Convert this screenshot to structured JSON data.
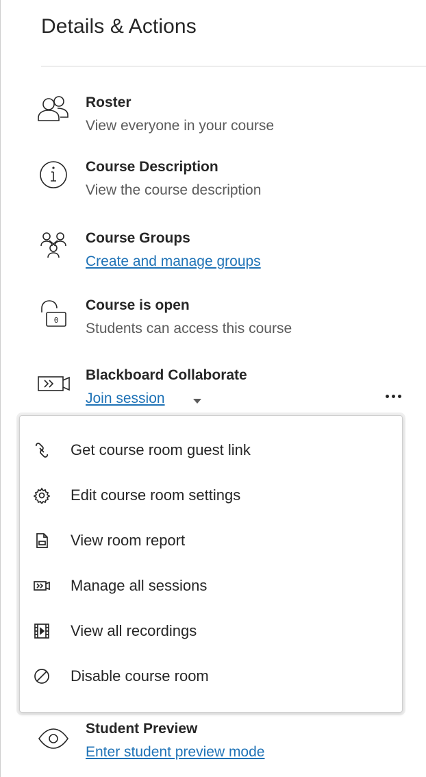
{
  "panel": {
    "title": "Details & Actions"
  },
  "items": [
    {
      "title": "Roster",
      "subtitle": "View everyone in your course"
    },
    {
      "title": "Course Description",
      "subtitle": "View the course description"
    },
    {
      "title": "Course Groups",
      "link": "Create and manage groups"
    },
    {
      "title": "Course is open",
      "subtitle": "Students can access this course"
    },
    {
      "title": "Blackboard Collaborate",
      "link": "Join session"
    }
  ],
  "menu": {
    "items": [
      {
        "label": "Get course room guest link",
        "icon": "link-icon"
      },
      {
        "label": "Edit course room settings",
        "icon": "gear-icon"
      },
      {
        "label": "View room report",
        "icon": "report-icon"
      },
      {
        "label": "Manage all sessions",
        "icon": "sessions-icon"
      },
      {
        "label": "View all recordings",
        "icon": "recordings-icon"
      },
      {
        "label": "Disable course room",
        "icon": "disable-icon"
      }
    ]
  },
  "student_preview": {
    "title": "Student Preview",
    "link": "Enter student preview mode"
  },
  "colors": {
    "link": "#1e72b6",
    "text": "#262626",
    "muted": "#5b5b5b"
  }
}
